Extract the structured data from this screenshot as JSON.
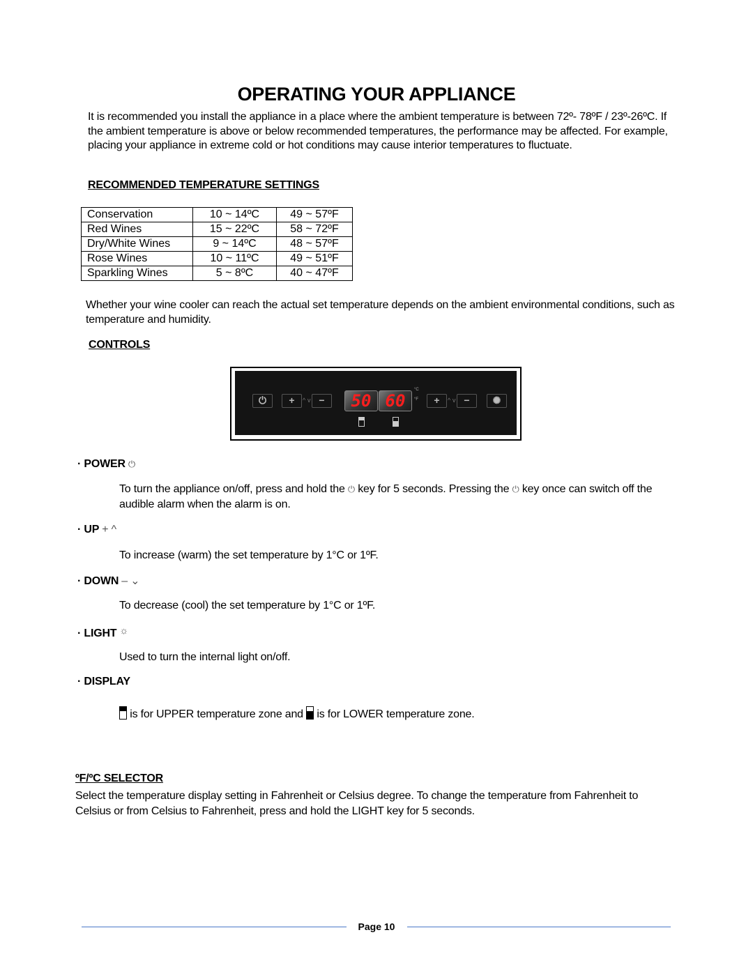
{
  "page": {
    "title": "OPERATING YOUR APPLIANCE",
    "intro": "It is recommended you install the appliance in a place where the ambient temperature is between 72º- 78ºF / 23º-26ºC.  If the ambient temperature is above or below recommended temperatures, the performance may be affected.  For example, placing your appliance in extreme cold or hot conditions may cause interior temperatures to fluctuate.",
    "page_number_label": "Page 10"
  },
  "temperature_settings": {
    "heading": "RECOMMENDED TEMPERATURE SETTINGS",
    "rows": [
      {
        "type": "Conservation",
        "celsius": "10 ~ 14ºC",
        "fahrenheit": "49 ~ 57ºF"
      },
      {
        "type": "Red Wines",
        "celsius": "15 ~ 22ºC",
        "fahrenheit": "58 ~ 72ºF"
      },
      {
        "type": "Dry/White Wines",
        "celsius": "9 ~ 14ºC",
        "fahrenheit": "48 ~ 57ºF"
      },
      {
        "type": "Rose Wines",
        "celsius": "10 ~ 11ºC",
        "fahrenheit": "49 ~ 51ºF"
      },
      {
        "type": "Sparkling Wines",
        "celsius": "5 ~ 8ºC",
        "fahrenheit": "40 ~ 47ºF"
      }
    ],
    "note": "Whether your wine cooler can reach the actual set temperature depends on the ambient environmental conditions, such as temperature and humidity."
  },
  "controls": {
    "heading": "CONTROLS",
    "panel": {
      "upper_display_value": "50",
      "lower_display_value": "60",
      "unit_c": "°C",
      "unit_f": "°F",
      "key_plus": "+",
      "key_minus": "−",
      "icons": [
        "power-icon",
        "plus-icon",
        "minus-icon",
        "light-icon",
        "upper-zone-icon",
        "lower-zone-icon"
      ]
    },
    "items": [
      {
        "label": "· POWER",
        "symbol": "⏻",
        "text_parts": [
          "To turn the appliance on/off, press and hold the ",
          "⏻",
          " key for 5 seconds.  Pressing the ",
          "⏻",
          " key once can switch off the audible alarm when the alarm is on."
        ]
      },
      {
        "label": "· UP",
        "symbol": "+ ^",
        "text": "To increase (warm) the set temperature by 1°C or 1ºF."
      },
      {
        "label": "· DOWN",
        "symbol": "– ⌄",
        "text": "To decrease (cool) the set temperature by 1°C or 1ºF."
      },
      {
        "label": "· LIGHT",
        "symbol": "☼",
        "text": "Used to turn the internal light on/off."
      },
      {
        "label": "· DISPLAY",
        "text_upper": "is for UPPER temperature zone and",
        "text_lower": "is for LOWER temperature zone."
      }
    ]
  },
  "selector": {
    "heading": "ºF/ºC SELECTOR",
    "text": "Select the temperature display setting in Fahrenheit or Celsius degree. To change the temperature from Fahrenheit to Celsius or from Celsius to Fahrenheit, press and hold the LIGHT key for 5 seconds."
  },
  "colors": {
    "display_digits": "#ff1e1e",
    "footer_rule": "#4a78c8",
    "panel_background": "#141414"
  }
}
